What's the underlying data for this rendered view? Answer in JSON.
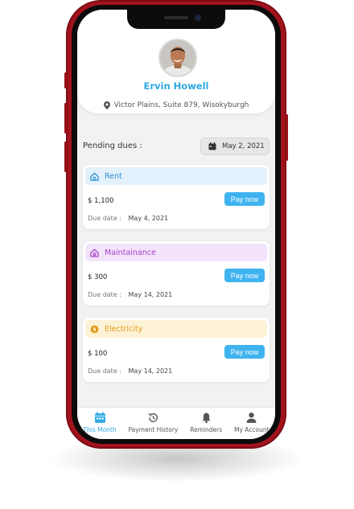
{
  "profile": {
    "name": "Ervin Howell",
    "address": "Victor Plains, Suite 879, Wisokyburgh"
  },
  "pending": {
    "label": "Pending dues :",
    "date": "May 2, 2021"
  },
  "bills": [
    {
      "title": "Rent",
      "icon": "home-icon",
      "amount": "$ 1,100",
      "due_label": "Due date :",
      "due_date": "May 4, 2021",
      "pay_label": "Pay now",
      "color": "#2e8fd4",
      "bg": "#e2f1fb"
    },
    {
      "title": "Maintainance",
      "icon": "house-gear-icon",
      "amount": "$ 300",
      "due_label": "Due date :",
      "due_date": "May 14, 2021",
      "pay_label": "Pay now",
      "color": "#a23fc9",
      "bg": "#f4e4fb"
    },
    {
      "title": "Electricity",
      "icon": "bolt-icon",
      "amount": "$ 100",
      "due_label": "Due date :",
      "due_date": "May 14, 2021",
      "pay_label": "Pay now",
      "color": "#e09a12",
      "bg": "#fdf2d6"
    }
  ],
  "tabs": [
    {
      "label": "This Month",
      "icon": "calendar-icon",
      "active": true
    },
    {
      "label": "Payment History",
      "icon": "history-icon",
      "active": false
    },
    {
      "label": "Reminders",
      "icon": "bell-icon",
      "active": false
    },
    {
      "label": "My Account",
      "icon": "person-icon",
      "active": false
    }
  ],
  "colors": {
    "accent": "#2ea8e3",
    "pay_button": "#3fb3ef",
    "phone": "#a3131d"
  }
}
